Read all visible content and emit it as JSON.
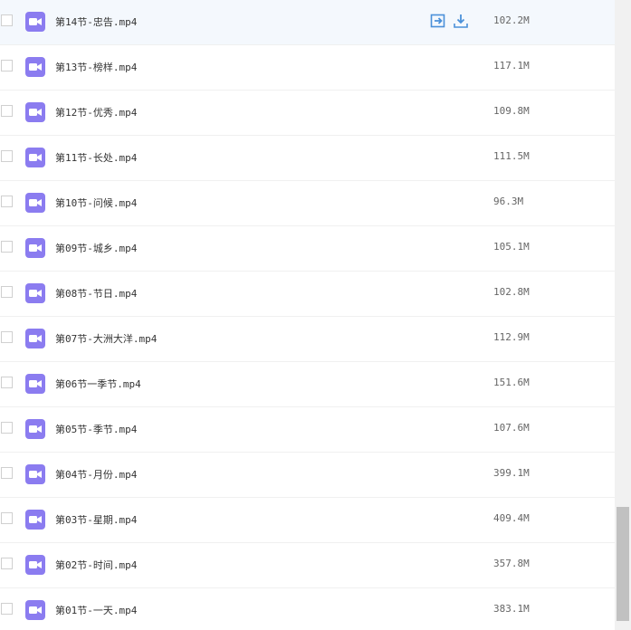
{
  "files": [
    {
      "name": "第14节-忠告.mp4",
      "size": "102.2M"
    },
    {
      "name": "第13节-榜样.mp4",
      "size": "117.1M"
    },
    {
      "name": "第12节-优秀.mp4",
      "size": "109.8M"
    },
    {
      "name": "第11节-长处.mp4",
      "size": "111.5M"
    },
    {
      "name": "第10节-问候.mp4",
      "size": "96.3M"
    },
    {
      "name": "第09节-城乡.mp4",
      "size": "105.1M"
    },
    {
      "name": "第08节-节日.mp4",
      "size": "102.8M"
    },
    {
      "name": "第07节-大洲大洋.mp4",
      "size": "112.9M"
    },
    {
      "name": "第06节一季节.mp4",
      "size": "151.6M"
    },
    {
      "name": "第05节-季节.mp4",
      "size": "107.6M"
    },
    {
      "name": "第04节-月份.mp4",
      "size": "399.1M"
    },
    {
      "name": "第03节-星期.mp4",
      "size": "409.4M"
    },
    {
      "name": "第02节-时间.mp4",
      "size": "357.8M"
    },
    {
      "name": "第01节-一天.mp4",
      "size": "383.1M"
    }
  ],
  "icons": {
    "file": "video-file-icon",
    "share": "share-icon",
    "download": "download-icon",
    "accent": "#8b7cf0",
    "action_color": "#4a90d9"
  }
}
